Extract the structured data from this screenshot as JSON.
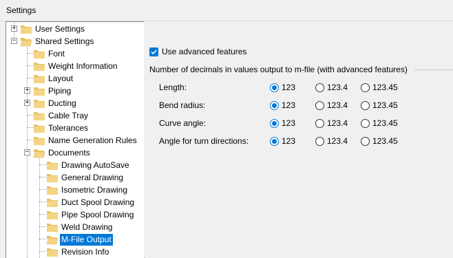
{
  "window": {
    "title": "Settings"
  },
  "tree": {
    "items": [
      {
        "label": "User Settings",
        "expander": "+"
      },
      {
        "label": "Shared Settings",
        "expander": "−"
      },
      {
        "label": "Font"
      },
      {
        "label": "Weight Information"
      },
      {
        "label": "Layout"
      },
      {
        "label": "Piping",
        "expander": "+"
      },
      {
        "label": "Ducting",
        "expander": "+"
      },
      {
        "label": "Cable Tray"
      },
      {
        "label": "Tolerances"
      },
      {
        "label": "Name Generation Rules"
      },
      {
        "label": "Documents",
        "expander": "−"
      },
      {
        "label": "Drawing AutoSave"
      },
      {
        "label": "General Drawing"
      },
      {
        "label": "Isometric Drawing"
      },
      {
        "label": "Duct Spool Drawing"
      },
      {
        "label": "Pipe Spool Drawing"
      },
      {
        "label": "Weld Drawing"
      },
      {
        "label": "M-File Output",
        "selected": true
      },
      {
        "label": "Revision Info"
      }
    ]
  },
  "panel": {
    "use_advanced_label": "Use advanced features",
    "use_advanced_checked": true,
    "group_title": "Number of decimals in values output to m-file (with advanced features)",
    "rows": [
      {
        "label": "Length:",
        "options": [
          "123",
          "123.4",
          "123.45"
        ],
        "selected": 0
      },
      {
        "label": "Bend radius:",
        "options": [
          "123",
          "123.4",
          "123.45"
        ],
        "selected": 0
      },
      {
        "label": "Curve angle:",
        "options": [
          "123",
          "123.4",
          "123.45"
        ],
        "selected": 0
      },
      {
        "label": "Angle for turn directions:",
        "options": [
          "123",
          "123.4",
          "123.45"
        ],
        "selected": 0
      }
    ]
  },
  "colors": {
    "accent": "#0078d7",
    "folder": "#e8c063",
    "folder_open": "#f3d585"
  }
}
